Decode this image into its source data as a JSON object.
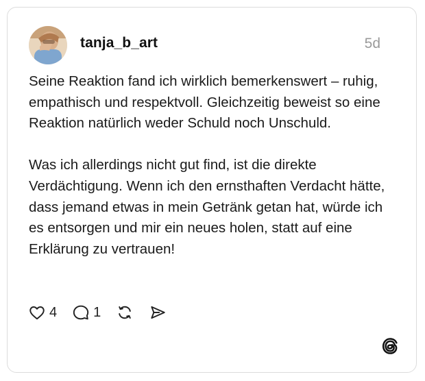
{
  "post": {
    "username": "tanja_b_art",
    "timestamp": "5d",
    "paragraphs": [
      "Seine Reaktion fand ich wirklich bemerkenswert – ruhig, empathisch und respektvoll. Gleichzeitig beweist so eine Reaktion natürlich weder Schuld noch Unschuld.",
      "Was ich allerdings nicht gut find, ist die direkte Verdächtigung. Wenn ich den ernsthaften Verdacht hätte, dass jemand etwas in mein Getränk getan hat, würde ich es entsorgen und mir ein neues holen, statt auf eine Erklärung zu vertrauen!"
    ]
  },
  "actions": {
    "like_count": "4",
    "reply_count": "1",
    "icons": {
      "like": "heart-icon",
      "reply": "comment-bubble-icon",
      "repost": "repost-icon",
      "share": "send-icon",
      "brand": "threads-logo-icon"
    }
  }
}
